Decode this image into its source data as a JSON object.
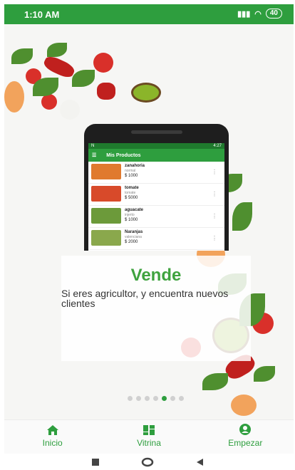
{
  "status_bar": {
    "time": "1:10 AM",
    "battery": "40"
  },
  "phone_screen": {
    "status_time": "4:27",
    "app_title": "Mis Productos",
    "products": [
      {
        "name": "zanahoria",
        "desc": "normal",
        "price": "$ 1000",
        "color": "#e07a2e"
      },
      {
        "name": "tomate",
        "desc": "tomate",
        "price": "$ 5000",
        "color": "#d84a2a"
      },
      {
        "name": "aguacate",
        "desc": "injerto",
        "price": "$ 1000",
        "color": "#6c9a3a"
      },
      {
        "name": "Naranjas",
        "desc": "valenciana",
        "price": "$ 2000",
        "color": "#8aa84c"
      }
    ]
  },
  "slide": {
    "title": "Vende",
    "subtitle": "Si eres agricultor, y encuentra nuevos clientes",
    "page_count": 7,
    "active_page_index": 4
  },
  "bottom_nav": {
    "items": [
      {
        "label": "Inicio",
        "icon": "home-icon"
      },
      {
        "label": "Vitrina",
        "icon": "dashboard-icon"
      },
      {
        "label": "Empezar",
        "icon": "account-circle-icon"
      }
    ]
  },
  "colors": {
    "brand_green": "#2e9e3e",
    "title_green": "#3fa33f"
  }
}
